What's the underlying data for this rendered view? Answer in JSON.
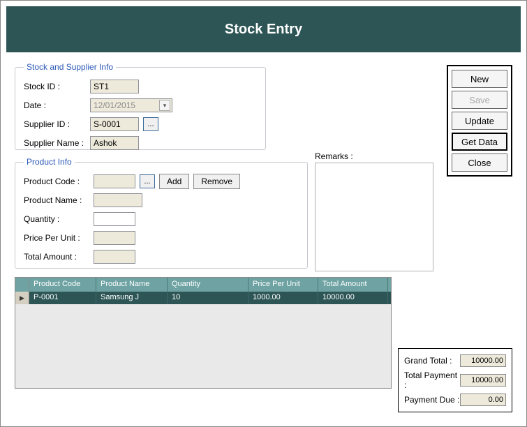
{
  "header": {
    "title": "Stock Entry"
  },
  "stock": {
    "legend": "Stock and Supplier Info",
    "labels": {
      "stock_id": "Stock ID :",
      "date": "Date :",
      "supplier_id": "Supplier ID :",
      "supplier_name": "Supplier Name :"
    },
    "values": {
      "stock_id": "ST1",
      "date": "12/01/2015",
      "supplier_id": "S-0001",
      "supplier_name": "Ashok"
    },
    "lookup_btn": "..."
  },
  "product": {
    "legend": "Product Info",
    "labels": {
      "code": "Product Code :",
      "name": "Product Name :",
      "qty": "Quantity :",
      "price": "Price Per Unit :",
      "total": "Total Amount :"
    },
    "values": {
      "code": "",
      "name": "",
      "qty": "",
      "price": "",
      "total": ""
    },
    "lookup_btn": "...",
    "add_btn": "Add",
    "remove_btn": "Remove"
  },
  "remarks": {
    "label": "Remarks :",
    "value": ""
  },
  "actions": {
    "new": "New",
    "save": "Save",
    "update": "Update",
    "getdata": "Get Data",
    "close": "Close"
  },
  "grid": {
    "headers": {
      "code": "Product Code",
      "name": "Product Name",
      "qty": "Quantity",
      "price": "Price Per Unit",
      "total": "Total Amount"
    },
    "rows": [
      {
        "code": "P-0001",
        "name": "Samsung J",
        "qty": "10",
        "price": "1000.00",
        "total": "10000.00"
      }
    ]
  },
  "totals": {
    "labels": {
      "grand": "Grand Total :",
      "payment": "Total Payment :",
      "due": "Payment Due :"
    },
    "values": {
      "grand": "10000.00",
      "payment": "10000.00",
      "due": "0.00"
    }
  }
}
